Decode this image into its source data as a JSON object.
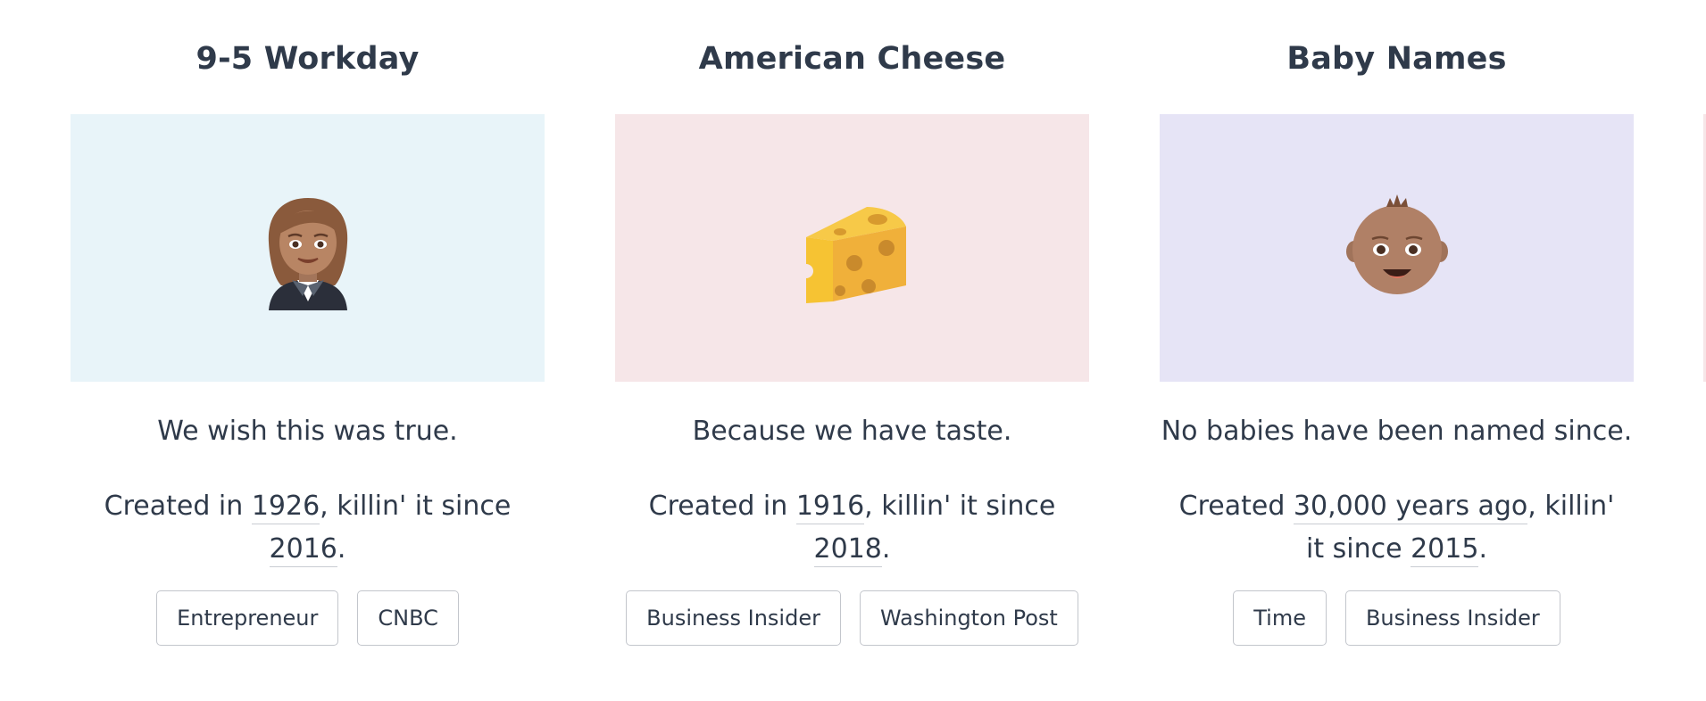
{
  "cards": [
    {
      "title": "9-5 Workday",
      "emoji": "businesswoman-icon",
      "bg_color": "#e8f4f9",
      "tagline": "We wish this was true.",
      "created_prefix": "Created in ",
      "created_value": "1926",
      "killin_text": ", killin' it since ",
      "since_value": "2016",
      "end": ".",
      "tags": [
        "Entrepreneur",
        "CNBC"
      ]
    },
    {
      "title": "American Cheese",
      "emoji": "cheese-icon",
      "bg_color": "#f6e6e8",
      "tagline": "Because we have taste.",
      "created_prefix": "Created in ",
      "created_value": "1916",
      "killin_text": ", killin' it since ",
      "since_value": "2018",
      "end": ".",
      "tags": [
        "Business Insider",
        "Washington Post"
      ]
    },
    {
      "title": "Baby Names",
      "emoji": "baby-icon",
      "bg_color": "#e6e4f6",
      "tagline": "No babies have been named since.",
      "created_prefix": "Created ",
      "created_value": "30,000 years ago",
      "killin_text": ", killin' it since ",
      "since_value": "2015",
      "end": ".",
      "tags": [
        "Time",
        "Business Insider"
      ]
    }
  ],
  "edge_color": "#f6e6e8"
}
